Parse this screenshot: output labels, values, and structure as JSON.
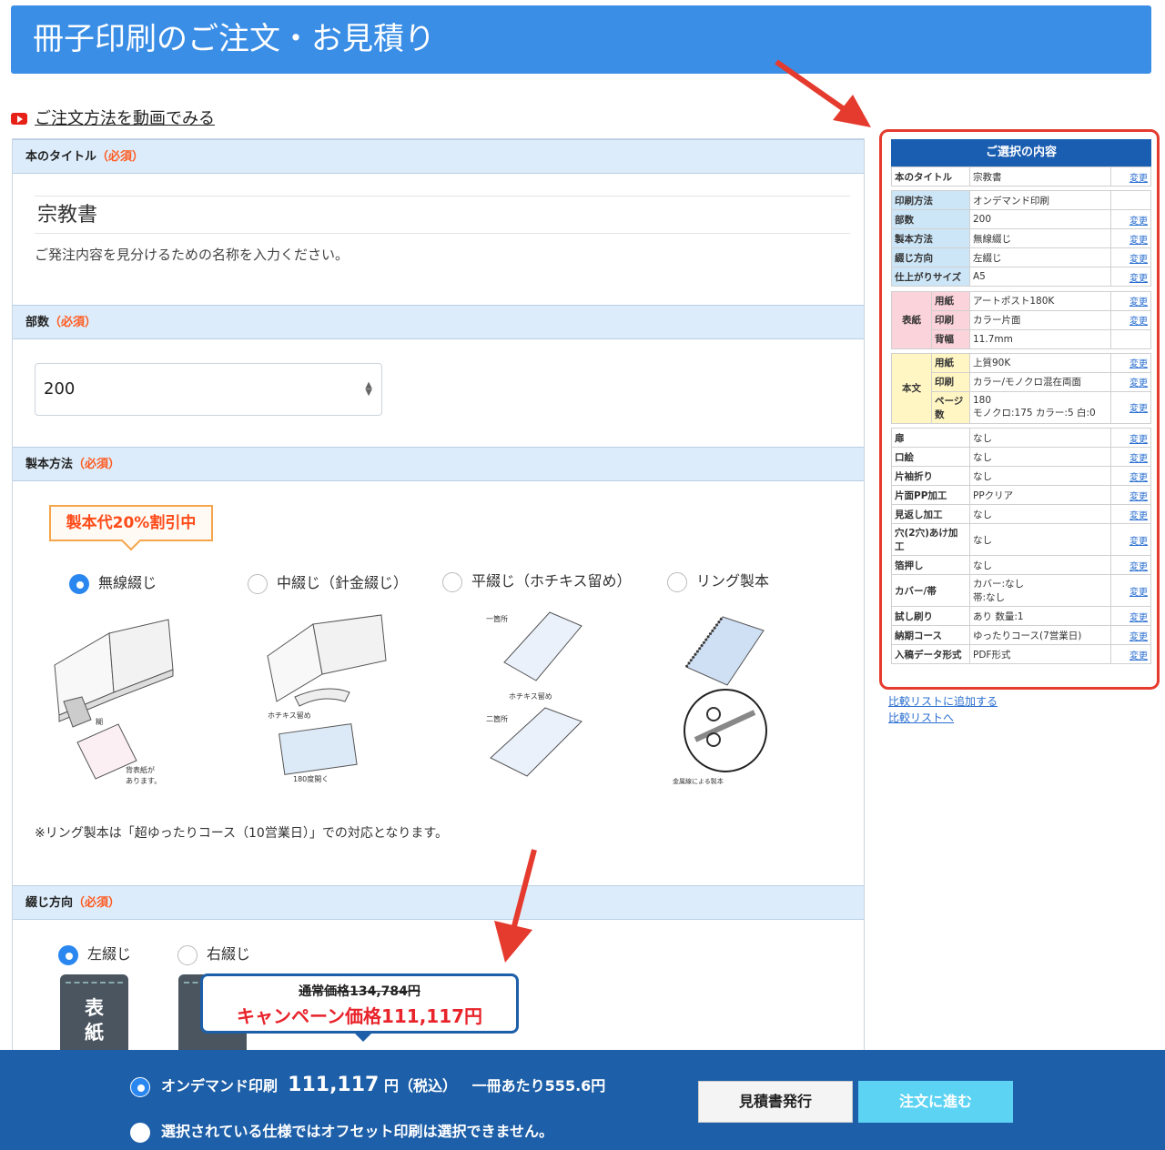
{
  "header": {
    "title": "冊子印刷のご注文・お見積り"
  },
  "video_link": "ご注文方法を動画でみる",
  "sections": {
    "title": {
      "label": "本のタイトル",
      "req": "（必須）",
      "value": "宗教書",
      "hint": "ご発注内容を見分けるための名称を入力ください。"
    },
    "quantity": {
      "label": "部数",
      "req": "（必須）",
      "value": "200"
    },
    "binding": {
      "label": "製本方法",
      "req": "（必須）",
      "discount": "製本代20%割引中",
      "options": [
        "無線綴じ",
        "中綴じ（針金綴じ）",
        "平綴じ（ホチキス留め）",
        "リング製本"
      ],
      "selected": 0,
      "captions": {
        "perfect1": "糊",
        "perfect2": "背表紙が\nあります。",
        "saddle1": "ホチキス留め",
        "saddle2": "180度開く",
        "side1": "一箇所",
        "side2": "ホチキス留め",
        "side3": "二箇所",
        "ring1": "金属線による製本"
      },
      "note": "※リング製本は「超ゆったりコース（10営業日）」での対応となります。"
    },
    "direction": {
      "label": "綴じ方向",
      "req": "（必須）",
      "options": [
        "左綴じ",
        "右綴じ"
      ],
      "selected": 0,
      "book_text": [
        "表",
        "紙"
      ]
    }
  },
  "summary": {
    "title": "ご選択の内容",
    "change": "変更",
    "top": [
      {
        "k": "本のタイトル",
        "v": "宗教書",
        "change": true
      }
    ],
    "spec": [
      {
        "k": "印刷方法",
        "v": "オンデマンド印刷",
        "change": false
      },
      {
        "k": "部数",
        "v": "200",
        "change": true
      },
      {
        "k": "製本方法",
        "v": "無線綴じ",
        "change": true
      },
      {
        "k": "綴じ方向",
        "v": "左綴じ",
        "change": true
      },
      {
        "k": "仕上がりサイズ",
        "v": "A5",
        "change": true
      }
    ],
    "cover": {
      "label": "表紙",
      "rows": [
        {
          "k": "用紙",
          "v": "アートポスト180K",
          "change": true
        },
        {
          "k": "印刷",
          "v": "カラー片面",
          "change": true
        },
        {
          "k": "背幅",
          "v": "11.7mm",
          "change": false
        }
      ]
    },
    "body": {
      "label": "本文",
      "rows": [
        {
          "k": "用紙",
          "v": "上質90K",
          "change": true
        },
        {
          "k": "印刷",
          "v": "カラー/モノクロ混在両面",
          "change": true
        },
        {
          "k": "ページ数",
          "v": "180\nモノクロ:175 カラー:5 白:0",
          "change": true
        }
      ]
    },
    "options": [
      {
        "k": "扉",
        "v": "なし"
      },
      {
        "k": "口絵",
        "v": "なし"
      },
      {
        "k": "片袖折り",
        "v": "なし"
      },
      {
        "k": "片面PP加工",
        "v": "PPクリア"
      },
      {
        "k": "見返し加工",
        "v": "なし"
      },
      {
        "k": "穴(2穴)あけ加工",
        "v": "なし"
      },
      {
        "k": "箔押し",
        "v": "なし"
      },
      {
        "k": "カバー/帯",
        "v": "カバー:なし\n帯:なし"
      },
      {
        "k": "試し刷り",
        "v": "あり 数量:1"
      },
      {
        "k": "納期コース",
        "v": "ゆったりコース(7営業日)"
      },
      {
        "k": "入稿データ形式",
        "v": "PDF形式"
      }
    ],
    "compare_add": "比較リストに追加する",
    "compare_go": "比較リストへ"
  },
  "price_popup": {
    "normal": "通常価格134,784円",
    "campaign": "キャンペーン価格111,117円"
  },
  "footer": {
    "ondemand_label": "オンデマンド印刷",
    "ondemand_price": "111,117",
    "ondemand_unit": "円（税込）",
    "per_copy": "一冊あたり555.6円",
    "offset_msg": "選択されている仕様ではオフセット印刷は選択できません。",
    "quote_button": "見積書発行",
    "order_button": "注文に進む"
  },
  "colors": {
    "header": "#3a8ee6",
    "footer": "#1d5fa8",
    "accent_red": "#e53a2e",
    "order_button": "#5dd3f3"
  }
}
